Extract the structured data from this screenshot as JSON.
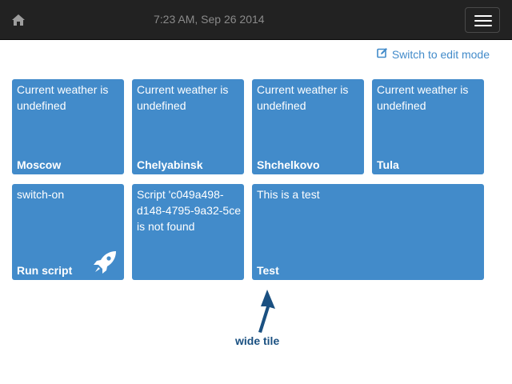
{
  "navbar": {
    "home_icon": "home-icon",
    "datetime": "7:23 AM, Sep 26 2014",
    "menu_icon": "hamburger-menu-icon"
  },
  "edit_mode": {
    "icon": "edit-icon",
    "label": "Switch to edit mode"
  },
  "tiles": [
    {
      "description": "Current weather is\nundefined",
      "title": "Moscow"
    },
    {
      "description": "Current weather is\nundefined",
      "title": "Chelyabinsk"
    },
    {
      "description": "Current weather is\nundefined",
      "title": "Shchelkovo"
    },
    {
      "description": "Current weather is\nundefined",
      "title": "Tula"
    },
    {
      "description": "switch-on",
      "title": "Run script",
      "icon": "rocket-icon"
    },
    {
      "description": "Script 'c049a498-\nd148-4795-9a32-5ce\nis not found",
      "title": ""
    },
    {
      "description": "This is a test",
      "title": "Test"
    }
  ],
  "annotation": {
    "label": "wide tile"
  },
  "colors": {
    "navbar_bg": "#222222",
    "tile_bg": "#428bca",
    "link": "#428bca",
    "annotation": "#1a5081"
  }
}
